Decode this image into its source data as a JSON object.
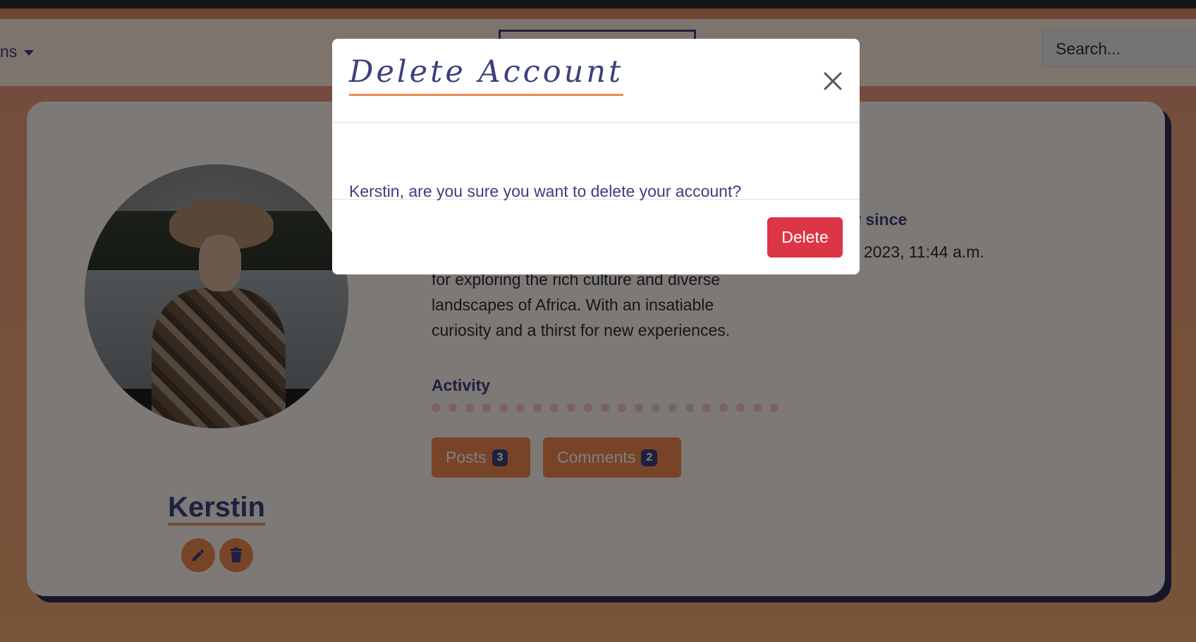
{
  "navbar": {
    "menu_fragment": "ns",
    "search_placeholder": "Search..."
  },
  "profile": {
    "username": "Kerstin",
    "bio_lines": [
      "for exploring the rich culture and diverse",
      "landscapes of Africa. With an insatiable",
      "curiosity and a thirst for new experiences."
    ],
    "member_since_label": "r since",
    "member_since_value": ", 2023, 11:44 a.m.",
    "activity_label": "Activity",
    "activity_dots": 21,
    "posts_label": "Posts",
    "posts_count": "3",
    "comments_label": "Comments",
    "comments_count": "2",
    "icons": {
      "edit": "pencil-icon",
      "delete": "trash-icon"
    }
  },
  "modal": {
    "title": "Delete Account",
    "message": "Kerstin, are you sure you want to delete your account?",
    "delete_label": "Delete",
    "close_icon": "close-icon"
  },
  "colors": {
    "accent_orange": "#f0894f",
    "navy": "#3e3f7e",
    "danger": "#dc3545",
    "card_shadow": "#2a2f52"
  }
}
